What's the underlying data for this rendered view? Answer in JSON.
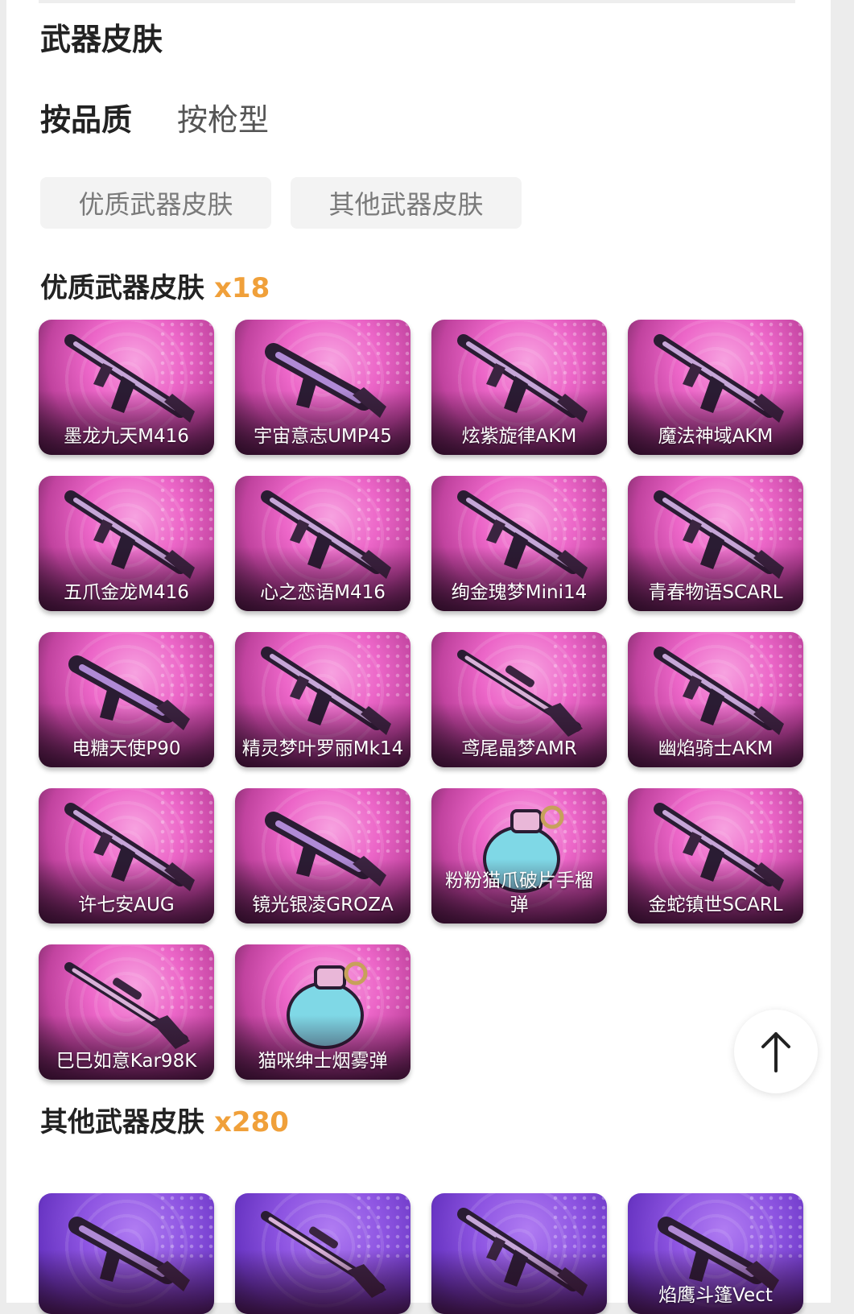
{
  "page": {
    "section_title": "武器皮肤"
  },
  "sort_tabs": [
    {
      "label": "按品质",
      "active": true
    },
    {
      "label": "按枪型",
      "active": false
    }
  ],
  "filters": [
    {
      "label": "优质武器皮肤"
    },
    {
      "label": "其他武器皮肤"
    }
  ],
  "premium": {
    "title": "优质武器皮肤",
    "count": "x18",
    "items": [
      {
        "name": "墨龙九天M416",
        "icon": "rifle-icon"
      },
      {
        "name": "宇宙意志UMP45",
        "icon": "smg-icon"
      },
      {
        "name": "炫紫旋律AKM",
        "icon": "rifle-icon"
      },
      {
        "name": "魔法神域AKM",
        "icon": "rifle-icon"
      },
      {
        "name": "五爪金龙M416",
        "icon": "rifle-icon"
      },
      {
        "name": "心之恋语M416",
        "icon": "rifle-icon"
      },
      {
        "name": "绚金瑰梦Mini14",
        "icon": "rifle-icon"
      },
      {
        "name": "青春物语SCARL",
        "icon": "rifle-icon"
      },
      {
        "name": "电糖天使P90",
        "icon": "smg-icon"
      },
      {
        "name": "精灵梦叶罗丽Mk14",
        "icon": "rifle-icon"
      },
      {
        "name": "鸢尾晶梦AMR",
        "icon": "sniper-icon"
      },
      {
        "name": "幽焰骑士AKM",
        "icon": "rifle-icon"
      },
      {
        "name": "许七安AUG",
        "icon": "rifle-icon"
      },
      {
        "name": "镜光银凌GROZA",
        "icon": "smg-icon"
      },
      {
        "name": "粉粉猫爪破片手榴弹",
        "icon": "grenade-icon"
      },
      {
        "name": "金蛇镇世SCARL",
        "icon": "rifle-icon"
      },
      {
        "name": "巳巳如意Kar98K",
        "icon": "sniper-icon"
      },
      {
        "name": "猫咪绅士烟雾弹",
        "icon": "grenade-icon"
      }
    ]
  },
  "others": {
    "title": "其他武器皮肤",
    "count": "x280",
    "items": [
      {
        "name": "",
        "icon": "smg-icon"
      },
      {
        "name": "",
        "icon": "sniper-icon"
      },
      {
        "name": "",
        "icon": "rifle-icon"
      },
      {
        "name": "焰鹰斗篷Vect",
        "icon": "smg-icon"
      }
    ]
  },
  "colors": {
    "accent_count": "#f0a03a",
    "premium_card": "#ec66c8",
    "other_card": "#8e55e2"
  },
  "back_to_top": {
    "icon": "arrow-up-icon"
  }
}
